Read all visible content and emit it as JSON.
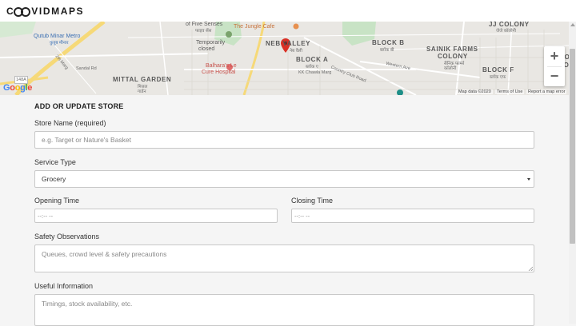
{
  "app": {
    "logo_prefix": "",
    "logo_main": "VID",
    "logo_suffix": "MAPS"
  },
  "map": {
    "labels": {
      "five_senses": "of Five Senses",
      "five_senses_hi": "फाइव सेंस",
      "jungle_cafe": "The Jungle Cafe",
      "neb_valley": "NEB VALLEY",
      "neb_valley_hi": "नेब वैली",
      "qutub_metro": "Qutub Minar Metro",
      "qutub_metro_hi": "कुतुब मीनार",
      "block_b": "BLOCK B",
      "block_b_hi": "ब्लॉक बी",
      "jj_colony": "JJ COLONY",
      "jj_colony_hi": "जेजे कॉलोनी",
      "sainik_farms": "SAINIK FARMS",
      "colony": "COLONY",
      "sainik_hi": "सैनिक फार्म्स",
      "colony_hi": "कॉलोनी",
      "block_a": "BLOCK A",
      "block_a_hi": "ब्लॉक ए",
      "temporarily_closed_1": "Temporarily",
      "temporarily_closed_2": "closed",
      "mittal_garden": "MITTAL GARDEN",
      "mittal_hi": "मित्तल",
      "mittal_hi2": "गार्डन",
      "balhara_1": "Balhara's Le",
      "balhara_2": "Cure Hospital",
      "kk_chawla": "KK Chawla Marg",
      "country_club": "Country Club Road",
      "block_f": "BLOCK F",
      "block_f_hi": "ब्लॉक एफ",
      "dugo": "DUGO",
      "colo": "COLO",
      "western_ave": "Western Ave",
      "sandal_rd": "Sandal Rd",
      "khasra_marg": "Khasra Marg",
      "route": "148A",
      "dalh_marg": "2th Marg",
      "chaupal": "Chaupal"
    },
    "footer": {
      "map_data": "Map data ©2020",
      "terms": "Terms of Use",
      "report": "Report a map error"
    },
    "google": [
      "G",
      "o",
      "o",
      "g",
      "l",
      "e"
    ],
    "google_colors": [
      "#4285F4",
      "#EA4335",
      "#FBBC05",
      "#4285F4",
      "#34A853",
      "#EA4335"
    ],
    "zoom_in": "+",
    "zoom_out": "−",
    "marker_color": "#d93025"
  },
  "form": {
    "title": "ADD OR UPDATE STORE",
    "store_name_label": "Store Name (required)",
    "store_name_placeholder": "e.g. Target or Nature's Basket",
    "service_type_label": "Service Type",
    "service_type_value": "Grocery",
    "opening_time_label": "Opening Time",
    "opening_time_placeholder": "--:-- --",
    "closing_time_label": "Closing Time",
    "closing_time_placeholder": "--:-- --",
    "safety_label": "Safety Observations",
    "safety_placeholder": "Queues, crowd level & safety precautions",
    "useful_label": "Useful Information",
    "useful_placeholder": "Timings, stock availability, etc."
  }
}
